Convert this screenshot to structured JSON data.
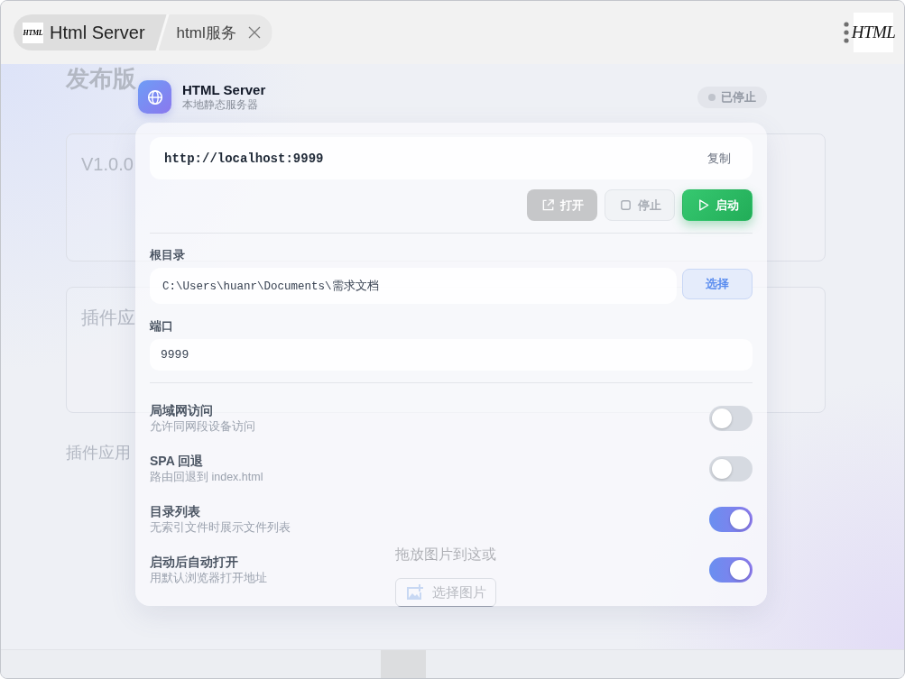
{
  "title_bar": {
    "app_tab": {
      "logo_text": "HTML",
      "label": "Html Server"
    },
    "page_tab": {
      "label": "html服务"
    },
    "logo_text": "HTML"
  },
  "background_page": {
    "title": "发布版",
    "sections": [
      {
        "label": "V1.0.0"
      },
      {
        "label": "插件应"
      }
    ],
    "screenshots_label": "插件应用",
    "drop_hint": "拖放图片到这或",
    "pick_button": "选择图片"
  },
  "server": {
    "name": "HTML Server",
    "subtitle": "本地静态服务器",
    "status": {
      "label": "已停止",
      "running": false
    },
    "url": "http://localhost:9999",
    "copy_button": "复制",
    "actions": [
      {
        "label": "打开",
        "kind": "open",
        "disabled": true
      },
      {
        "label": "停止",
        "kind": "stop",
        "disabled": true
      },
      {
        "label": "启动",
        "kind": "start",
        "disabled": false
      }
    ],
    "root_dir": {
      "label": "根目录",
      "value": "C:\\Users\\huanr\\Documents\\需求文档",
      "button": "选择"
    },
    "port": {
      "label": "端口",
      "value": "9999"
    },
    "toggles": [
      {
        "title": "局域网访问",
        "subtitle": "允许同网段设备访问",
        "on": false
      },
      {
        "title": "SPA 回退",
        "subtitle": "路由回退到 index.html",
        "on": false
      },
      {
        "title": "目录列表",
        "subtitle": "无索引文件时展示文件列表",
        "on": true
      },
      {
        "title": "启动后自动打开",
        "subtitle": "用默认浏览器打开地址",
        "on": true
      }
    ]
  }
}
